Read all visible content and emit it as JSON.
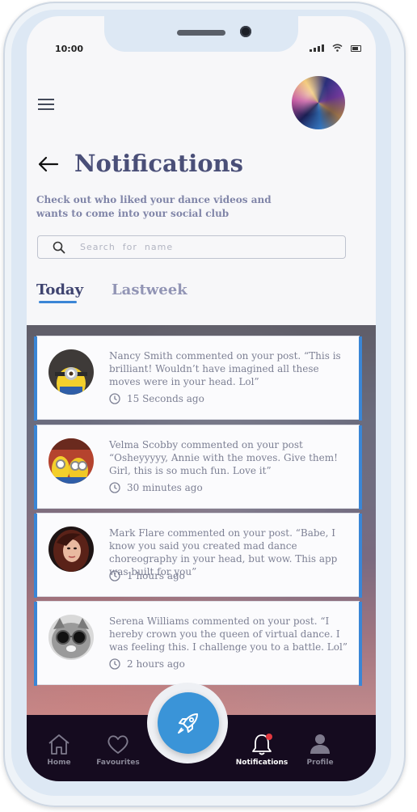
{
  "status_bar": {
    "time": "10:00"
  },
  "header": {
    "title": "Notifications",
    "subtitle": "Check out who liked your dance videos and wants to come into your social club"
  },
  "search": {
    "placeholder": "Search  for  name"
  },
  "tabs": [
    {
      "label": "Today",
      "active": true
    },
    {
      "label": "Lastweek",
      "active": false
    }
  ],
  "notifications": [
    {
      "text": "Nancy Smith commented on your post. “This is brilliant! Wouldn’t have imagined all these moves were in your head. Lol”",
      "time": "15 Seconds ago",
      "avatar": "minion-avatar"
    },
    {
      "text": "Velma Scobby commented on your post “Osheyyyyy, Annie with the moves. Give them! Girl, this is so much fun. Love it”",
      "time": "30 minutes ago",
      "avatar": "minions-group-avatar"
    },
    {
      "text": "Mark Flare commented on your post. “Babe, I know you said you created mad dance choreography in your head, but wow. This app was built for you”",
      "time": "1 hours ago",
      "avatar": "woman-portrait-avatar"
    },
    {
      "text": "Serena Williams commented on your post. “I hereby crown you the queen of virtual dance. I was feeling this. I challenge you to a battle. Lol”",
      "time": "2 hours ago",
      "avatar": "cat-sunglasses-avatar"
    }
  ],
  "nav": {
    "home": "Home",
    "favourites": "Favourites",
    "notifications": "Notifications",
    "profile": "Profile",
    "active": "notifications"
  },
  "colors": {
    "accent": "#3a94d8",
    "title": "#4a4f78",
    "nav_bg": "#150b1f",
    "badge": "#e2383f"
  }
}
